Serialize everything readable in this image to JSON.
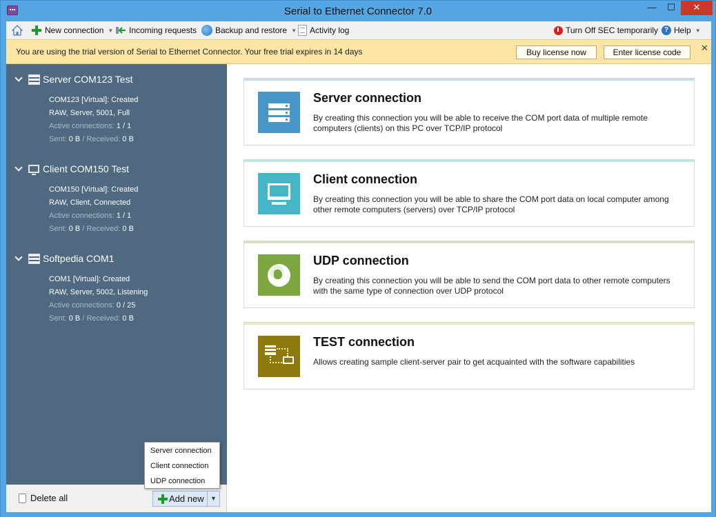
{
  "window": {
    "title": "Serial to Ethernet Connector 7.0",
    "minimize": "—",
    "maximize": "☐",
    "close": "✕"
  },
  "toolbar": {
    "new_connection": "New connection",
    "incoming_requests": "Incoming requests",
    "backup_restore": "Backup and restore",
    "activity_log": "Activity log",
    "turn_off_sec": "Turn Off SEC temporarily",
    "help": "Help",
    "dropdown_glyph": "▼",
    "help_glyph": "?"
  },
  "trial": {
    "message": "You are using the trial version of Serial to Ethernet Connector. Your free trial expires in 14 days",
    "buy_label": "Buy license now",
    "enter_label": "Enter license code",
    "close": "✕"
  },
  "sidebar": {
    "connections": [
      {
        "name": "Server COM123 Test",
        "icon": "server-icon",
        "line1": "COM123 [Virtual]: Created",
        "line2": "RAW, Server, 5001, Full",
        "active_label": "Active connections:",
        "active_value": "1 / 1",
        "sent_label": "Sent:",
        "sent_value": "0 B",
        "received_label": "/ Received:",
        "received_value": "0 B"
      },
      {
        "name": "Client COM150 Test",
        "icon": "computer-icon",
        "line1": "COM150 [Virtual]: Created",
        "line2": "RAW, Client, Connected",
        "active_label": "Active connections:",
        "active_value": "1 / 1",
        "sent_label": "Sent:",
        "sent_value": "0 B",
        "received_label": "/ Received:",
        "received_value": "0 B"
      },
      {
        "name": "Softpedia COM1",
        "icon": "server-icon",
        "line1": "COM1 [Virtual]: Created",
        "line2": "RAW, Server, 5002, Listening",
        "active_label": "Active connections:",
        "active_value": "0 / 25",
        "sent_label": "Sent:",
        "sent_value": "0 B",
        "received_label": "/ Received:",
        "received_value": "0 B"
      }
    ],
    "delete_all": "Delete all",
    "add_new": "Add new",
    "add_new_arrow": "▼"
  },
  "add_menu": {
    "items": [
      "Server connection",
      "Client connection",
      "UDP connection"
    ]
  },
  "cards": [
    {
      "title": "Server connection",
      "description": "By creating this connection you will be able to receive the COM port data of multiple remote computers (clients) on this PC over TCP/IP protocol",
      "color": "#4796c7"
    },
    {
      "title": "Client connection",
      "description": "By creating this connection you will be able to share the COM port data on local computer among other remote computers (servers) over TCP/IP protocol",
      "color": "#45b6c6"
    },
    {
      "title": "UDP connection",
      "description": "By creating this connection you will be able to send the COM port data to other remote computers with the same type of connection over UDP protocol",
      "color": "#7ba640"
    },
    {
      "title": "TEST connection",
      "description": "Allows creating sample client-server pair to get acquainted with the software capabilities",
      "color": "#8d7a0e"
    }
  ],
  "colors": {
    "sidebar_bg": "#4e6980",
    "trial_bg": "#fbe6a6",
    "window_frame": "#56a5e3",
    "close_button": "#c7392b"
  }
}
